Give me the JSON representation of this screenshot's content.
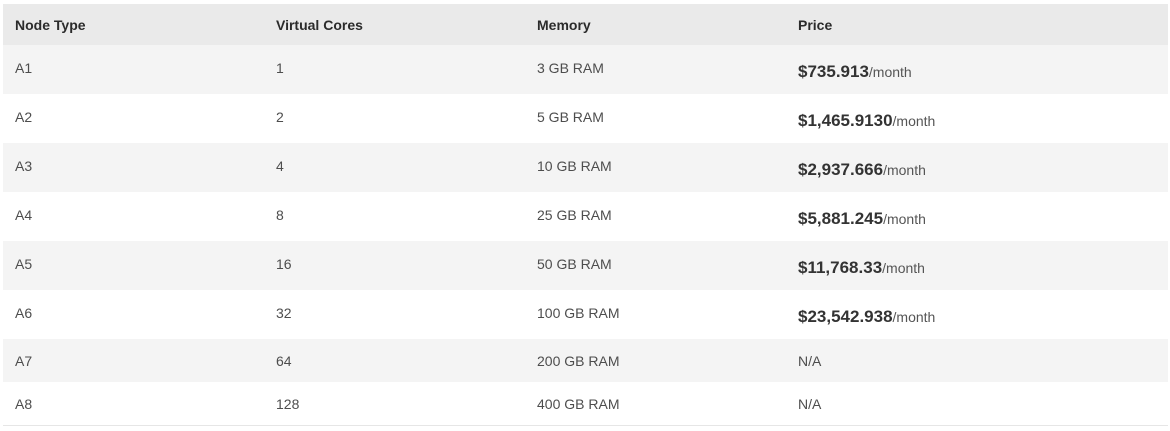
{
  "columns": [
    "Node Type",
    "Virtual Cores",
    "Memory",
    "Price"
  ],
  "rows": [
    {
      "node": "A1",
      "cores": "1",
      "memory": "3 GB RAM",
      "price": "$735.913",
      "unit": "/month"
    },
    {
      "node": "A2",
      "cores": "2",
      "memory": "5 GB RAM",
      "price": "$1,465.9130",
      "unit": "/month"
    },
    {
      "node": "A3",
      "cores": "4",
      "memory": "10 GB RAM",
      "price": "$2,937.666",
      "unit": "/month"
    },
    {
      "node": "A4",
      "cores": "8",
      "memory": "25 GB RAM",
      "price": "$5,881.245",
      "unit": "/month"
    },
    {
      "node": "A5",
      "cores": "16",
      "memory": "50 GB RAM",
      "price": "$11,768.33",
      "unit": "/month"
    },
    {
      "node": "A6",
      "cores": "32",
      "memory": "100 GB RAM",
      "price": "$23,542.938",
      "unit": "/month"
    },
    {
      "node": "A7",
      "cores": "64",
      "memory": "200 GB RAM",
      "price": "N/A",
      "unit": ""
    },
    {
      "node": "A8",
      "cores": "128",
      "memory": "400 GB RAM",
      "price": "N/A",
      "unit": ""
    }
  ]
}
